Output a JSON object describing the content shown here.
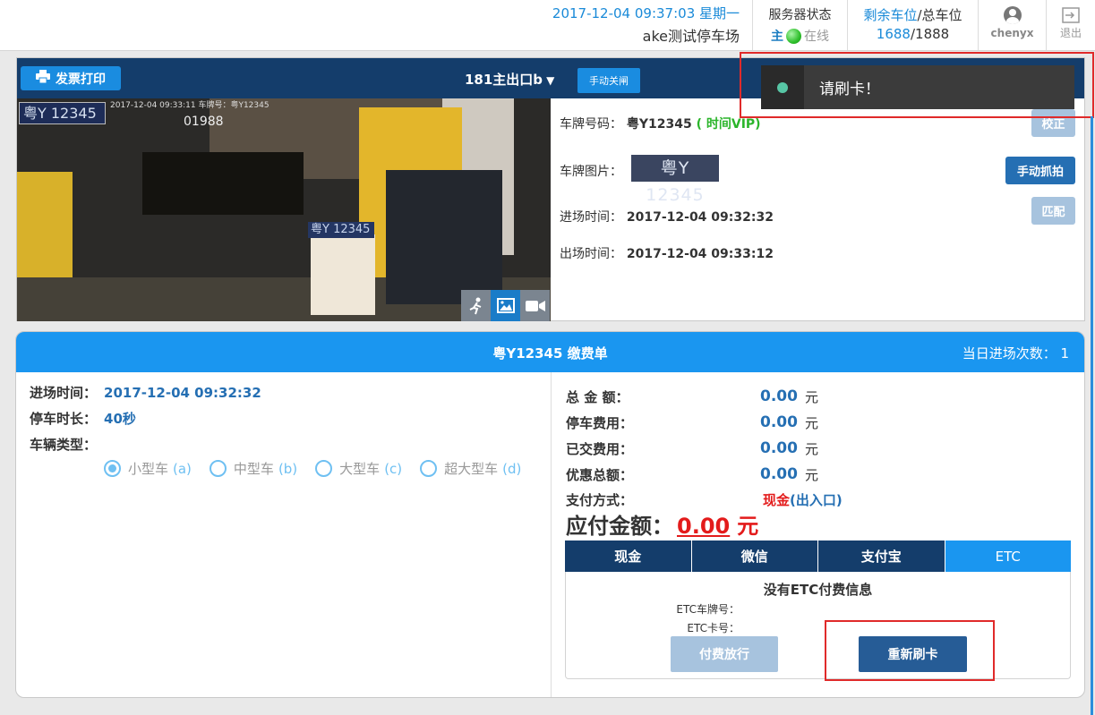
{
  "header": {
    "datetime": "2017-12-04 09:37:03 星期一",
    "lot_name": "ake测试停车场",
    "server": {
      "label": "服务器状态",
      "main": "主",
      "status": "在线"
    },
    "parking": {
      "remaining_label": "剩余车位",
      "sep": "/",
      "total_label": "总车位",
      "remaining": "1688",
      "total": "1888"
    },
    "user": "chenyx",
    "logout": "退出"
  },
  "exit_panel": {
    "invoice_button": "发票打印",
    "gate_name": "181主出口b",
    "gate_arrow": "▼",
    "close_gate_button": "手动关闸",
    "plate_overlay": "粤Y 12345",
    "osd_text": "2017-12-04 09:33:11  车牌号：粤Y12345",
    "osd_text2": "01988",
    "plate_mid": "粤Y 12345",
    "plate_label": "车牌号码：",
    "plate_value": "粤Y12345",
    "plate_tag": "( 时间VIP)",
    "plate_img_label": "车牌图片：",
    "plate_img_text": "粤Y 12345",
    "entry_label": "进场时间：",
    "entry_value": "2017-12-04 09:32:32",
    "exit_label": "出场时间：",
    "exit_value": "2017-12-04 09:33:12",
    "correct_button": "校正",
    "capture_button": "手动抓拍",
    "match_button": "匹配"
  },
  "toast": {
    "message": "请刷卡！",
    "dot_color": "#57c6a5"
  },
  "bill": {
    "title": "粤Y12345  缴费单",
    "daily_count": "当日进场次数： 1",
    "entry_label": "进场时间：",
    "entry_value": "2017-12-04 09:32:32",
    "duration_label": "停车时长：",
    "duration_value": "40秒",
    "vehicle_type_label": "车辆类型：",
    "vehicle_types": [
      {
        "label": "小型车",
        "key": "(a)",
        "selected": true
      },
      {
        "label": "中型车",
        "key": "(b)",
        "selected": false
      },
      {
        "label": "大型车",
        "key": "(c)",
        "selected": false
      },
      {
        "label": "超大型车",
        "key": "(d)",
        "selected": false
      }
    ],
    "fees": [
      {
        "label": "总 金 额：",
        "amount": "0.00",
        "unit": "元"
      },
      {
        "label": "停车费用：",
        "amount": "0.00",
        "unit": "元"
      },
      {
        "label": "已交费用：",
        "amount": "0.00",
        "unit": "元"
      },
      {
        "label": "优惠总额：",
        "amount": "0.00",
        "unit": "元"
      }
    ],
    "pay_method_label": "支付方式：",
    "pay_method_value": "现金",
    "pay_method_where": "(出入口)",
    "due_label": "应付金额：",
    "due_value": "0.00",
    "due_unit": "元",
    "tabs": [
      "现金",
      "微信",
      "支付宝",
      "ETC"
    ],
    "active_tab": "ETC",
    "etc_none": "没有ETC付费信息",
    "etc_plate_label": "ETC车牌号：",
    "etc_card_label": "ETC卡号：",
    "release_button": "付费放行",
    "reswipe_button": "重新刷卡"
  },
  "colors": {
    "header_dark": "#143d6b",
    "accent_blue": "#1a96f0",
    "alert_red": "#e31b1b",
    "vip_green": "#2bb52b"
  }
}
